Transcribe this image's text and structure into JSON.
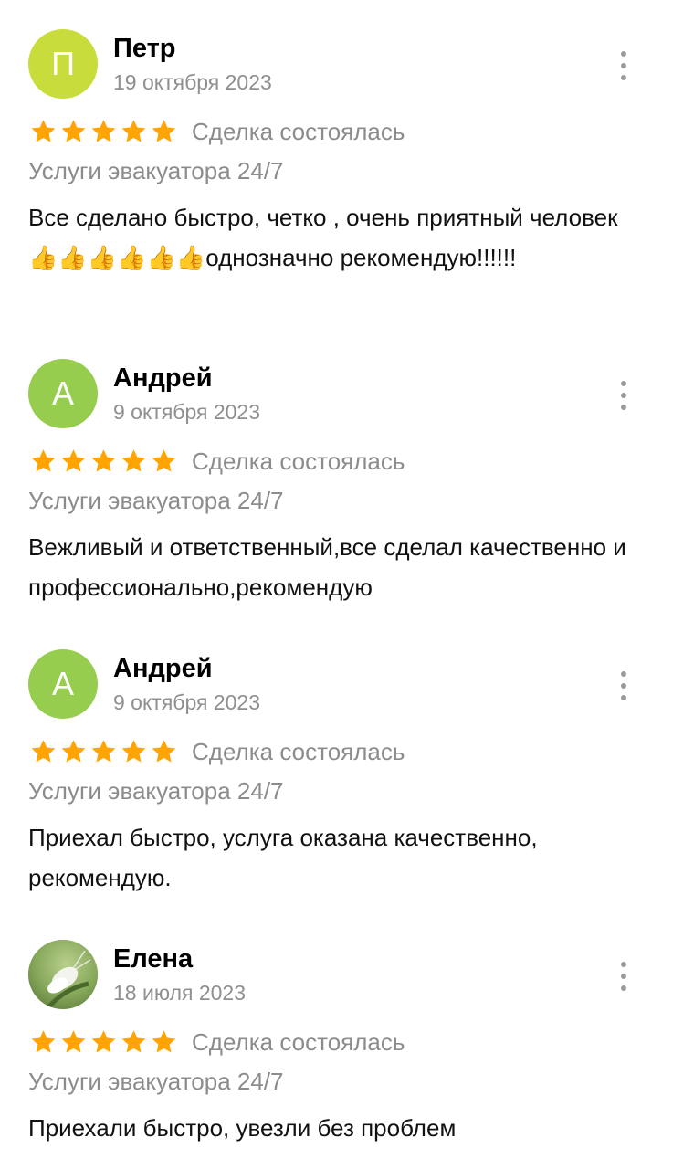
{
  "reviews": [
    {
      "name": "Петр",
      "initial": "П",
      "avatar_color": "#c8dc3c",
      "date": "19 октября 2023",
      "rating": 5,
      "deal": "Сделка состоялась",
      "service": "Услуги эвакуатора 24/7",
      "text": "Все сделано быстро, четко , очень приятный человек 👍👍👍👍👍👍однозначно рекомендую!!!!!!"
    },
    {
      "name": "Андрей",
      "initial": "А",
      "avatar_color": "#97cd4e",
      "date": "9 октября 2023",
      "rating": 5,
      "deal": "Сделка состоялась",
      "service": "Услуги эвакуатора 24/7",
      "text": "Вежливый и ответственный,все сделал качественно и профессионально,рекомендую"
    },
    {
      "name": "Андрей",
      "initial": "А",
      "avatar_color": "#97cd4e",
      "date": "9 октября 2023",
      "rating": 5,
      "deal": "Сделка состоялась",
      "service": "Услуги эвакуатора 24/7",
      "text": "Приехал быстро, услуга оказана качественно, рекомендую."
    },
    {
      "name": "Елена",
      "initial": "",
      "avatar_color": "#8fb06a",
      "date": "18 июля 2023",
      "rating": 5,
      "deal": "Сделка состоялась",
      "service": "Услуги эвакуатора 24/7",
      "text": "Приехали быстро, увезли без проблем"
    }
  ],
  "star_color": "#ffa400",
  "icons": {
    "more": "more-vertical-icon",
    "star": "star-icon",
    "photo": "moth-photo"
  }
}
